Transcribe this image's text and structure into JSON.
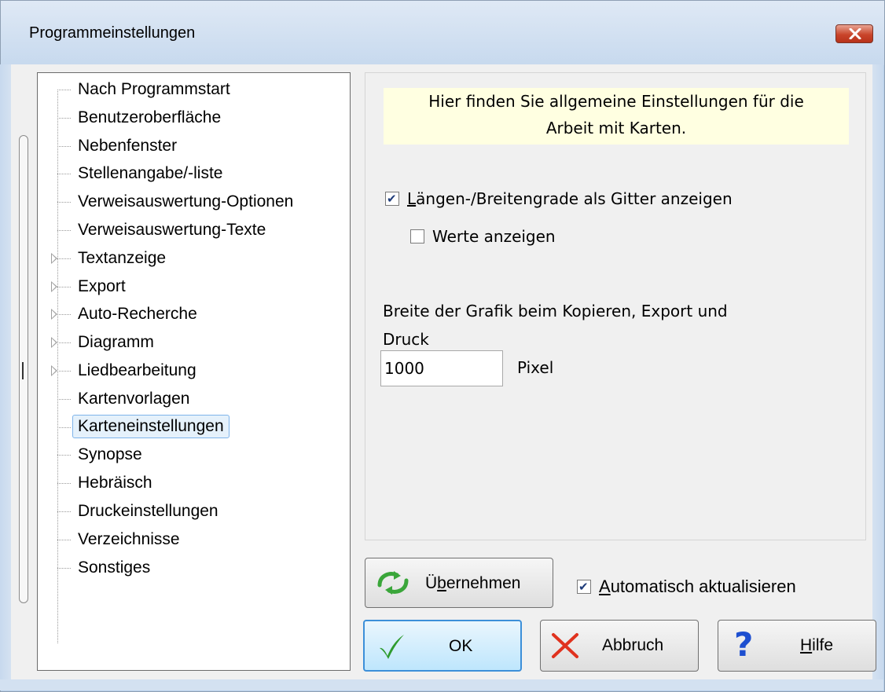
{
  "window": {
    "title": "Programmeinstellungen"
  },
  "tree": {
    "items": [
      {
        "label": "Nach Programmstart",
        "expandable": false,
        "selected": false
      },
      {
        "label": "Benutzeroberfläche",
        "expandable": false,
        "selected": false
      },
      {
        "label": "Nebenfenster",
        "expandable": false,
        "selected": false
      },
      {
        "label": "Stellenangabe/-liste",
        "expandable": false,
        "selected": false
      },
      {
        "label": "Verweisauswertung-Optionen",
        "expandable": false,
        "selected": false
      },
      {
        "label": "Verweisauswertung-Texte",
        "expandable": false,
        "selected": false
      },
      {
        "label": "Textanzeige",
        "expandable": true,
        "selected": false
      },
      {
        "label": "Export",
        "expandable": true,
        "selected": false
      },
      {
        "label": "Auto-Recherche",
        "expandable": true,
        "selected": false
      },
      {
        "label": "Diagramm",
        "expandable": true,
        "selected": false
      },
      {
        "label": "Liedbearbeitung",
        "expandable": true,
        "selected": false
      },
      {
        "label": "Kartenvorlagen",
        "expandable": false,
        "selected": false
      },
      {
        "label": "Karteneinstellungen",
        "expandable": false,
        "selected": true
      },
      {
        "label": "Synopse",
        "expandable": false,
        "selected": false
      },
      {
        "label": "Hebräisch",
        "expandable": false,
        "selected": false
      },
      {
        "label": "Druckeinstellungen",
        "expandable": false,
        "selected": false
      },
      {
        "label": "Verzeichnisse",
        "expandable": false,
        "selected": false
      },
      {
        "label": "Sonstiges",
        "expandable": false,
        "selected": false
      }
    ]
  },
  "panel": {
    "info_line1": "Hier finden Sie allgemeine Einstellungen für die",
    "info_line2": "Arbeit mit Karten.",
    "grid_checkbox": {
      "label_first": "L",
      "label_rest": "ängen-/Breitengrade als Gitter anzeigen",
      "checked": true
    },
    "values_checkbox": {
      "label": "Werte anzeigen",
      "checked": false
    },
    "width_label_line1": "Breite der Grafik beim Kopieren, Export und",
    "width_label_line2": "Druck",
    "width_value": "1000",
    "width_unit": "Pixel"
  },
  "footer": {
    "apply_label_pre": "Ü",
    "apply_label_ul": "b",
    "apply_label_post": "ernehmen",
    "auto_update": {
      "label_first": "A",
      "label_rest": "utomatisch aktualisieren",
      "checked": true
    },
    "ok_label": "OK",
    "cancel_label": "Abbruch",
    "help_label_ul": "H",
    "help_label_rest": "ilfe"
  },
  "colors": {
    "info_background": "#ffffe1",
    "selection_border": "#7eb4ea",
    "default_button_border": "#3c8fd9"
  }
}
